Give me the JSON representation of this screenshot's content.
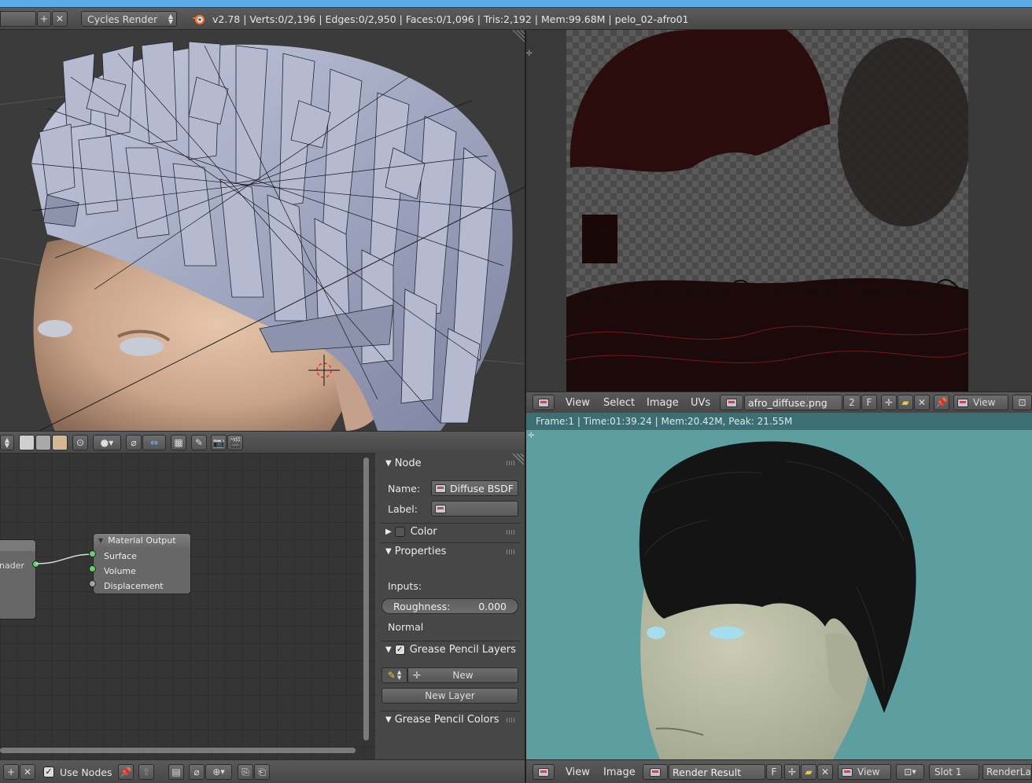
{
  "info": {
    "engine": "Cycles Render",
    "stats": "v2.78 | Verts:0/2,196 | Edges:0/2,950 | Faces:0/1,096 | Tris:2,192 | Mem:99.68M | pelo_02-afro01"
  },
  "uv_editor": {
    "menus": [
      "View",
      "Select",
      "Image",
      "UVs"
    ],
    "image_name": "afro_diffuse.png",
    "users": "2",
    "fake": "F",
    "view_label": "View"
  },
  "render_view": {
    "status": "Frame:1 | Time:01:39.24 | Mem:20.42M, Peak: 21.55M",
    "menus": [
      "View",
      "Image"
    ],
    "image_name": "Render Result",
    "fake": "F",
    "view_label": "View",
    "slot": "Slot 1",
    "layer": "RenderLay"
  },
  "node_editor": {
    "use_nodes_label": "Use Nodes",
    "partial_node_text": "nader",
    "material_output": {
      "title": "Material Output",
      "sockets": [
        "Surface",
        "Volume",
        "Displacement"
      ]
    }
  },
  "properties": {
    "node_header": "Node",
    "name_label": "Name:",
    "name_value": "Diffuse BSDF",
    "label_label": "Label:",
    "color_header": "Color",
    "properties_header": "Properties",
    "inputs_label": "Inputs:",
    "roughness_label": "Roughness:",
    "roughness_value": "0.000",
    "normal_label": "Normal",
    "grease_layers_header": "Grease Pencil Layers",
    "new_button": "New",
    "new_layer_button": "New Layer",
    "grease_colors_header": "Grease Pencil Colors"
  },
  "colors": {
    "accent_blue": "#5aaae6",
    "socket_green": "#6bd06b",
    "render_bg": "#5d9fa0",
    "skin": "#c9a48a",
    "hair_mesh": "#aeb3c8"
  }
}
